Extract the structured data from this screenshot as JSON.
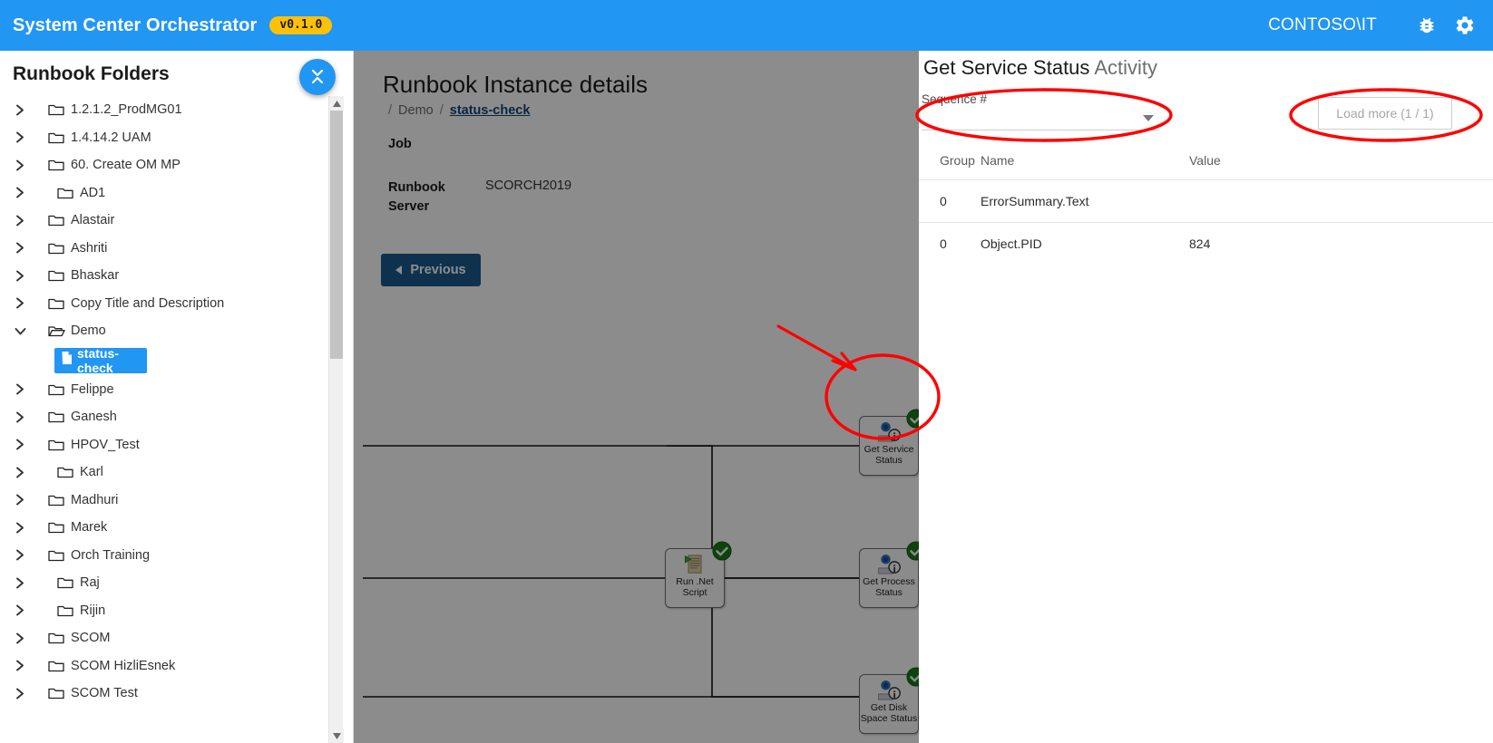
{
  "header": {
    "app_title": "System Center Orchestrator",
    "version": "v0.1.0",
    "user": "CONTOSO\\IT",
    "bug_icon": "bug-icon",
    "settings_icon": "gear-icon"
  },
  "sidebar": {
    "title": "Runbook Folders",
    "collapse_toggle_icon": "chevron-down-up-icon",
    "items": [
      {
        "label": "1.2.1.2_ProdMG01",
        "type": "folder",
        "expanded": false,
        "indent": false
      },
      {
        "label": "1.4.14.2 UAM",
        "type": "folder",
        "expanded": false,
        "indent": false
      },
      {
        "label": "60. Create OM MP",
        "type": "folder",
        "expanded": false,
        "indent": false
      },
      {
        "label": "AD1",
        "type": "folder",
        "expanded": false,
        "indent": true
      },
      {
        "label": "Alastair",
        "type": "folder",
        "expanded": false,
        "indent": false
      },
      {
        "label": "Ashriti",
        "type": "folder",
        "expanded": false,
        "indent": false
      },
      {
        "label": "Bhaskar",
        "type": "folder",
        "expanded": false,
        "indent": false
      },
      {
        "label": "Copy Title and Description",
        "type": "folder",
        "expanded": false,
        "indent": false
      },
      {
        "label": "Demo",
        "type": "folder-open",
        "expanded": true,
        "indent": false
      },
      {
        "label": "status-check",
        "type": "runbook",
        "selected": true
      },
      {
        "label": "Felippe",
        "type": "folder",
        "expanded": false,
        "indent": false
      },
      {
        "label": "Ganesh",
        "type": "folder",
        "expanded": false,
        "indent": false
      },
      {
        "label": "HPOV_Test",
        "type": "folder",
        "expanded": false,
        "indent": false
      },
      {
        "label": "Karl",
        "type": "folder",
        "expanded": false,
        "indent": true
      },
      {
        "label": "Madhuri",
        "type": "folder",
        "expanded": false,
        "indent": false
      },
      {
        "label": "Marek",
        "type": "folder",
        "expanded": false,
        "indent": false
      },
      {
        "label": "Orch Training",
        "type": "folder",
        "expanded": false,
        "indent": false
      },
      {
        "label": "Raj",
        "type": "folder",
        "expanded": false,
        "indent": true
      },
      {
        "label": "Rijin",
        "type": "folder",
        "expanded": false,
        "indent": true
      },
      {
        "label": "SCOM",
        "type": "folder",
        "expanded": false,
        "indent": false
      },
      {
        "label": "SCOM HizliEsnek",
        "type": "folder",
        "expanded": false,
        "indent": false
      },
      {
        "label": "SCOM Test",
        "type": "folder",
        "expanded": false,
        "indent": false
      }
    ]
  },
  "main": {
    "page_title": "Runbook Instance details",
    "breadcrumb": {
      "sep": "/",
      "folder": "Demo",
      "runbook": "status-check"
    },
    "job_label": "Job",
    "job_value": "",
    "runbook_server_label": "Runbook Server",
    "runbook_server_value": "SCORCH2019",
    "previous_button": "Previous"
  },
  "diagram": {
    "nodes": [
      {
        "id": "get-service-status",
        "label": "Get Service Status",
        "status": "success",
        "icon": "service-status-icon",
        "highlighted": true
      },
      {
        "id": "run-dotnet-script",
        "label": "Run .Net Script",
        "status": "success",
        "icon": "script-icon",
        "highlighted": false
      },
      {
        "id": "get-process-status",
        "label": "Get Process Status",
        "status": "success",
        "icon": "service-status-icon",
        "highlighted": false
      },
      {
        "id": "get-disk-space-status",
        "label": "Get Disk Space Status",
        "status": "success",
        "icon": "service-status-icon",
        "highlighted": false
      }
    ],
    "annotation_arrow": "red-arrow-pointing-to-get-service-status"
  },
  "panel": {
    "title": "Get Service Status",
    "title_suffix": "Activity",
    "sequence_label": "Sequence #",
    "sequence_value": "",
    "load_more_label": "Load more (1 / 1)",
    "table": {
      "columns": [
        "Group",
        "Name",
        "Value"
      ],
      "rows": [
        {
          "group": "0",
          "name": "ErrorSummary.Text",
          "value": ""
        },
        {
          "group": "0",
          "name": "Object.PID",
          "value": "824"
        }
      ]
    }
  },
  "colors": {
    "header_blue": "#2196f3",
    "badge_yellow": "#ffc107",
    "annotation_red": "#ff0000",
    "button_blue": "#1b5c8f",
    "success_green": "#1a7a1a"
  }
}
